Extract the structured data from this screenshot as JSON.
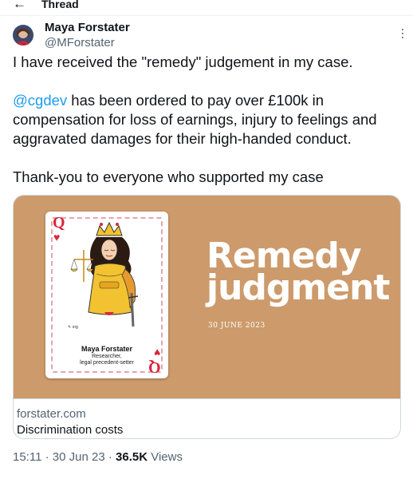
{
  "header": {
    "back_icon": "arrow-left-icon",
    "title": "Thread"
  },
  "author": {
    "name": "Maya Forstater",
    "handle": "@MForstater",
    "avatar": "avatar-photo"
  },
  "tweet": {
    "line1": "I have received the \"remedy\" judgement in my case.",
    "mention": "@cgdev",
    "line2_rest": " has been ordered to pay over £100k in compensation for loss of earnings, injury to feelings and aggravated damages for their high-handed conduct.",
    "line3": "Thank-you to everyone who supported my case"
  },
  "card": {
    "image": {
      "background_color": "#cd9a6b",
      "playing_card": {
        "rank": "Q",
        "suit": "heart-icon",
        "name": "Maya Forstater",
        "role_line1": "Researcher,",
        "role_line2": "legal precedent-setter"
      },
      "headline": "Remedy\njudgment",
      "date": "30 JUNE 2023"
    },
    "domain": "forstater.com",
    "title": "Discrimination costs"
  },
  "meta": {
    "time": "15:11",
    "sep1": " · ",
    "date": "30 Jun 23",
    "sep2": " · ",
    "views_count": "36.5K",
    "views_label": " Views"
  },
  "colors": {
    "accent": "#1d9bf0",
    "text": "#0f1419",
    "secondary": "#536471"
  }
}
